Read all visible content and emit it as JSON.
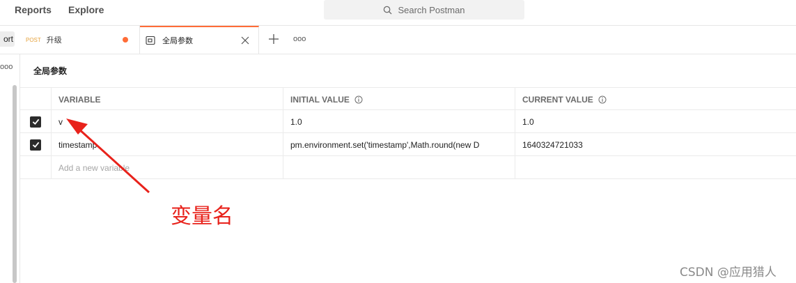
{
  "topbar": {
    "nav": [
      "Reports",
      "Explore"
    ],
    "search_placeholder": "Search Postman"
  },
  "tabs": {
    "side_button": "ort",
    "items": [
      {
        "method": "POST",
        "name": "升级",
        "unsaved": true
      },
      {
        "name": "全局参数",
        "active": true
      }
    ],
    "more": "ooo"
  },
  "sidebar": {
    "more": "ooo"
  },
  "page": {
    "title": "全局参数"
  },
  "table": {
    "headers": [
      "VARIABLE",
      "INITIAL VALUE",
      "CURRENT VALUE"
    ],
    "rows": [
      {
        "checked": true,
        "variable": "v",
        "initial": "1.0",
        "current": "1.0"
      },
      {
        "checked": true,
        "variable": "timestamp",
        "initial": "pm.environment.set('timestamp',Math.round(new D",
        "current": "1640324721033"
      }
    ],
    "add_placeholder": "Add a new variable"
  },
  "annotation": {
    "text": "变量名",
    "color": "#e8221b"
  },
  "watermark": "CSDN @应用猎人",
  "colors": {
    "accent": "#ff6c37",
    "method_post": "#e6a23c"
  }
}
